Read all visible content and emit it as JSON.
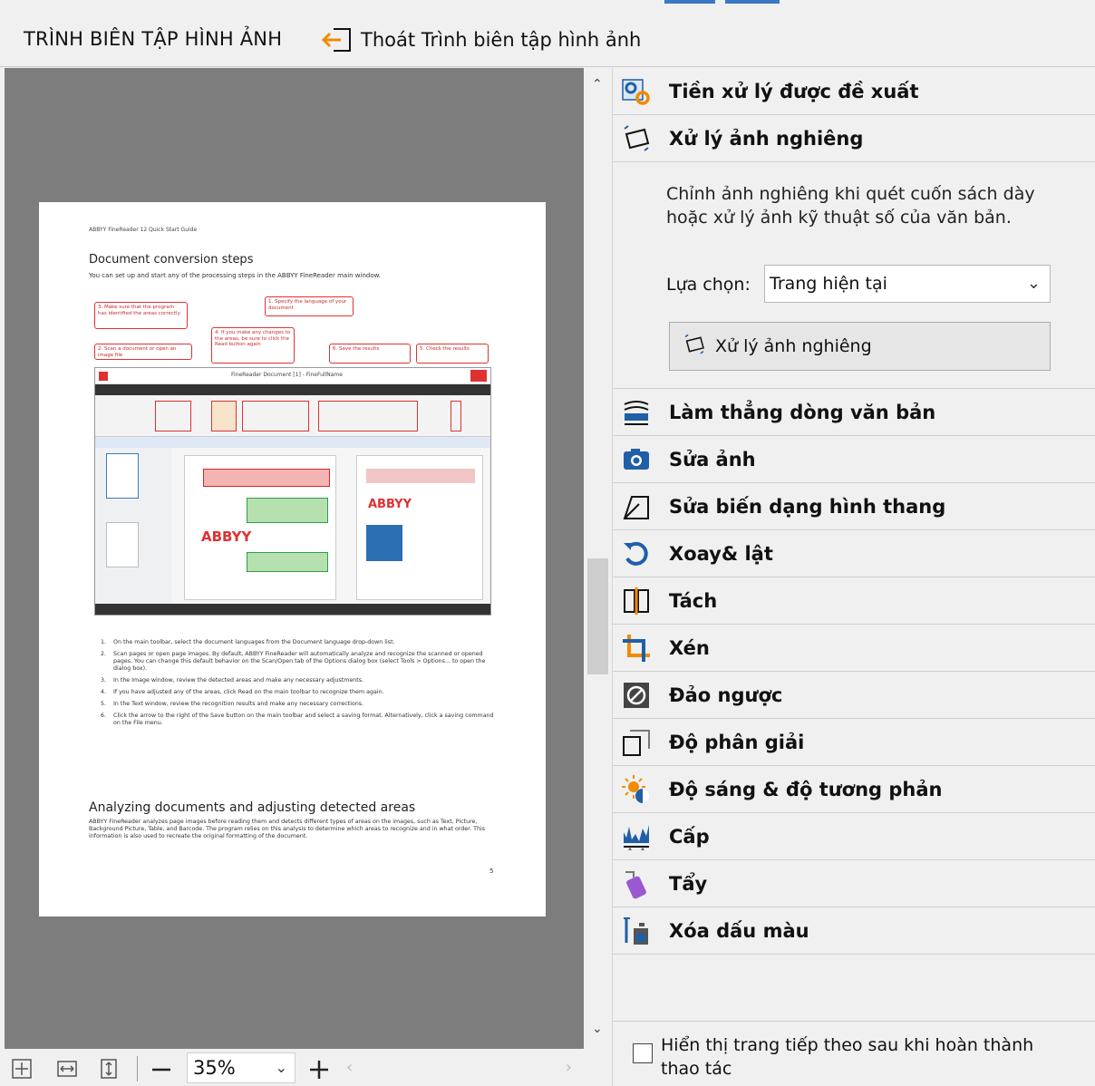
{
  "toolbar": {
    "title": "TRÌNH BIÊN TẬP HÌNH ẢNH",
    "exit_label": "Thoát Trình biên tập hình ảnh"
  },
  "document": {
    "header": "ABBYY FineReader 12 Quick Start Guide",
    "heading1": "Document conversion steps",
    "subtitle": "You can set up and start any of the processing steps in the ABBYY FineReader main window.",
    "callouts": [
      "1. Specify the language of your document",
      "3. Make sure that the program has identified the areas correctly",
      "2. Scan a document or open an image file",
      "4. If you make any changes to the areas, be sure to click the Read button again",
      "6. Save the results",
      "5. Check the results"
    ],
    "screenshot_title": "FineReader Document [1] - FineFullName",
    "steps": [
      {
        "n": "1.",
        "text": "On the main toolbar, select the document languages from the Document language drop-down list."
      },
      {
        "n": "2.",
        "text": "Scan pages or open page images. By default, ABBYY FineReader will automatically analyze and recognize the scanned or opened pages. You can change this default behavior on the Scan/Open tab of the Options dialog box (select Tools > Options... to open the dialog box)."
      },
      {
        "n": "3.",
        "text": "In the Image window, review the detected areas and make any necessary adjustments."
      },
      {
        "n": "4.",
        "text": "If you have adjusted any of the areas, click Read on the main toolbar to recognize them again."
      },
      {
        "n": "5.",
        "text": "In the Text window, review the recognition results and make any necessary corrections."
      },
      {
        "n": "6.",
        "text": "Click the arrow to the right of the Save button on the main toolbar and select a saving format. Alternatively, click a saving command on the File menu."
      }
    ],
    "heading2": "Analyzing documents and adjusting detected areas",
    "paragraph": "ABBYY FineReader analyzes page images before reading them and detects different types of areas on the images, such as Text, Picture, Background Picture, Table, and Barcode. The program relies on this analysis to determine which areas to recognize and in what order. This information is also used to recreate the original formatting of the document.",
    "page_number": "5"
  },
  "bottom": {
    "zoom_value": "35%"
  },
  "panel": {
    "items": [
      {
        "label": "Tiền xử lý được đề xuất",
        "icon": "gears-icon"
      },
      {
        "label": "Xử lý ảnh nghiêng",
        "icon": "skew-icon"
      },
      {
        "label": "Làm thẳng dòng văn bản",
        "icon": "straighten-lines-icon"
      },
      {
        "label": "Sửa ảnh",
        "icon": "camera-icon"
      },
      {
        "label": "Sửa biến dạng hình thang",
        "icon": "trapezoid-icon"
      },
      {
        "label": "Xoay& lật",
        "icon": "rotate-icon"
      },
      {
        "label": "Tách",
        "icon": "split-icon"
      },
      {
        "label": "Xén",
        "icon": "crop-icon"
      },
      {
        "label": "Đảo ngược",
        "icon": "invert-icon"
      },
      {
        "label": "Độ phân giải",
        "icon": "resolution-icon"
      },
      {
        "label": "Độ sáng & độ tương phản",
        "icon": "brightness-icon"
      },
      {
        "label": "Cấp",
        "icon": "levels-icon"
      },
      {
        "label": "Tẩy",
        "icon": "eraser-icon"
      },
      {
        "label": "Xóa dấu màu",
        "icon": "remove-color-marks-icon"
      }
    ],
    "skew": {
      "description": "Chỉnh ảnh nghiêng khi quét cuốn sách dày hoặc xử lý ảnh kỹ thuật số của văn bản.",
      "select_label": "Lựa chọn:",
      "select_value": "Trang hiện tại",
      "button_label": "Xử lý ảnh nghiêng"
    },
    "footer_checkbox": "Hiển thị trang tiếp theo sau khi hoàn thành thao tác"
  },
  "colors": {
    "accent": "#3b78c4",
    "viewer_bg": "#7d7d7d",
    "callout_red": "#e03131",
    "icon_blue": "#1f5fa8",
    "icon_orange": "#f08c00",
    "icon_purple": "#9b59d0"
  }
}
